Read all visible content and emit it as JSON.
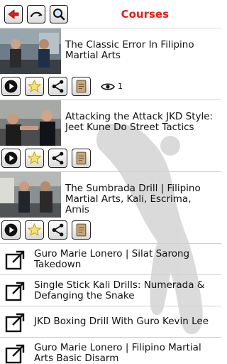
{
  "header": {
    "title": "Courses",
    "back_icon": "back-arrow-icon",
    "home_icon": "home-icon",
    "search_icon": "search-icon",
    "accent_color": "#e0201a"
  },
  "videos": [
    {
      "title": "The Classic Error In Filipino Martial Arts",
      "views": "1"
    },
    {
      "title": "Attacking the Attack JKD Style: Jeet Kune Do Street Tactics"
    },
    {
      "title": "The Sumbrada Drill | Filipino Martial Arts, Kali, Escrima, Arnis"
    }
  ],
  "links": [
    {
      "title": "Guro Marie Lonero | Silat Sarong Takedown"
    },
    {
      "title": "Single Stick Kali Drills: Numerada & Defanging the Snake"
    },
    {
      "title": "JKD Boxing Drill With Guro Kevin Lee"
    },
    {
      "title": "Guro Marie Lonero | Filipino Martial Arts Basic Disarm"
    }
  ]
}
